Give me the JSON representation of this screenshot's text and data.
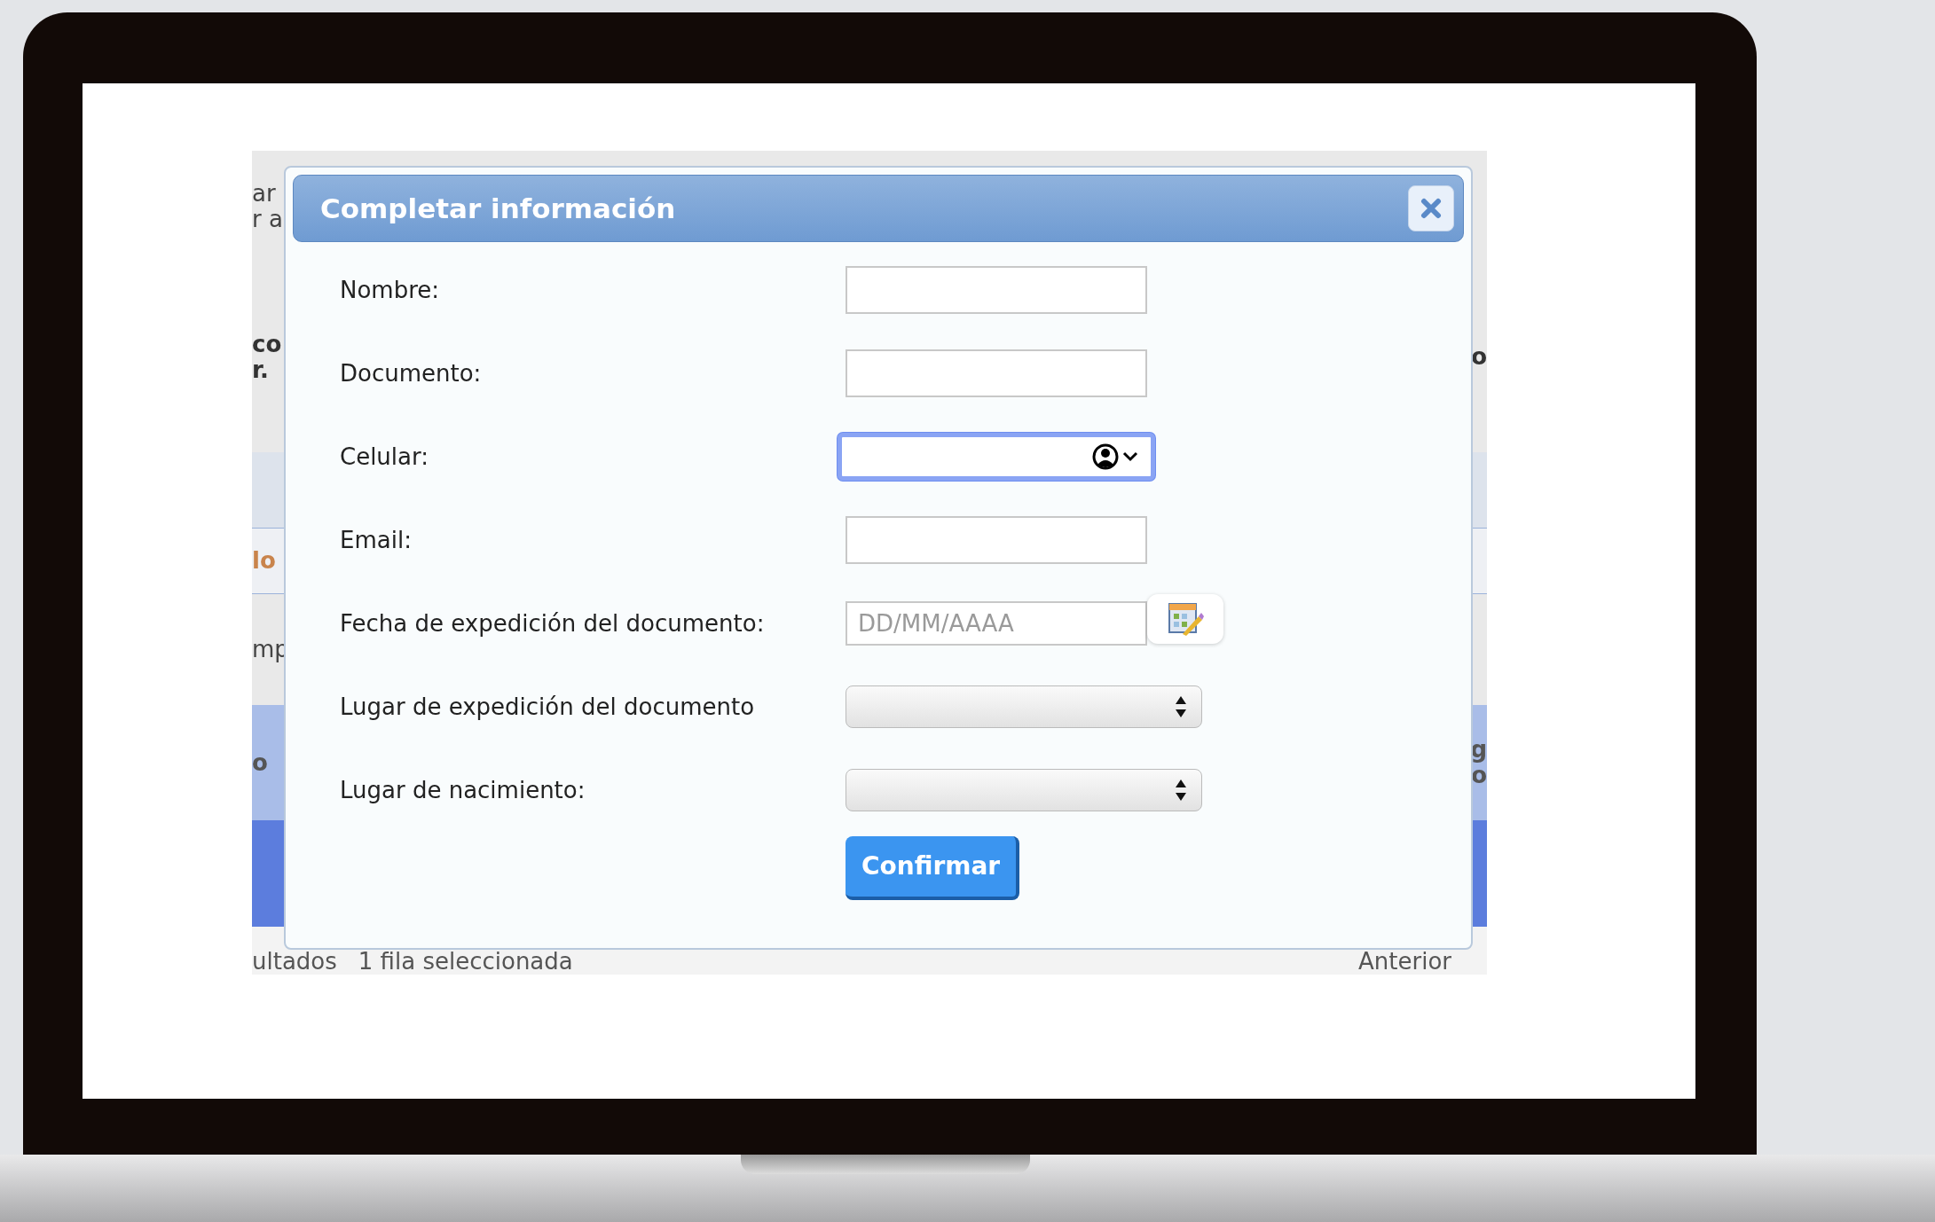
{
  "background": {
    "strips": [
      {
        "kind": "plain",
        "left": [
          "ar",
          "r a"
        ]
      },
      {
        "kind": "heading",
        "left": [
          "co",
          "r."
        ],
        "right": [
          "o"
        ]
      },
      {
        "kind": "band"
      },
      {
        "kind": "accent",
        "left": [
          "lo"
        ]
      },
      {
        "kind": "plain",
        "left": [
          "mp"
        ]
      },
      {
        "kind": "header",
        "left": [
          "o"
        ],
        "right": [
          "g",
          "o"
        ]
      },
      {
        "kind": "selected"
      }
    ],
    "footer": {
      "left": [
        "ultados",
        "1 fila seleccionada"
      ],
      "right": [
        "Anterior"
      ]
    }
  },
  "dialog": {
    "title": "Completar información",
    "fields": [
      {
        "label": "Nombre:",
        "kind": "text",
        "focused": false
      },
      {
        "label": "Documento:",
        "kind": "text",
        "focused": false
      },
      {
        "label": "Celular:",
        "kind": "phone",
        "focused": true
      },
      {
        "label": "Email:",
        "kind": "text",
        "focused": false
      },
      {
        "label": "Fecha de expedición del documento:",
        "kind": "date",
        "placeholder": "DD/MM/AAAA",
        "focused": false
      },
      {
        "label": "Lugar de expedición del documento",
        "kind": "select",
        "focused": false
      },
      {
        "label": "Lugar de nacimiento:",
        "kind": "select",
        "focused": false
      }
    ],
    "confirm_button": "Confirmar"
  }
}
